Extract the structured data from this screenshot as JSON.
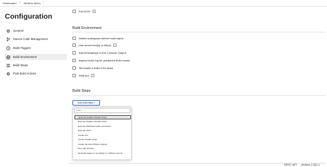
{
  "breadcrumb": {
    "items": [
      "Dashboard",
      "Jenkins demo"
    ],
    "separator": "›"
  },
  "page_title": "Configuration",
  "sidebar": {
    "items": [
      {
        "label": "General",
        "icon": "gear-icon",
        "active": false
      },
      {
        "label": "Source Code Management",
        "icon": "code-branch-icon",
        "active": false
      },
      {
        "label": "Build Triggers",
        "icon": "clock-icon",
        "active": false
      },
      {
        "label": "Build Environment",
        "icon": "globe-icon",
        "active": true
      },
      {
        "label": "Build Steps",
        "icon": "list-icon",
        "active": false
      },
      {
        "label": "Post-build Actions",
        "icon": "gear-icon",
        "active": false
      }
    ]
  },
  "triggers": {
    "poll_scm_label": "Poll SCM",
    "help": "?"
  },
  "build_environment": {
    "title": "Build Environment",
    "options": [
      {
        "label": "Delete workspace before build starts",
        "help": ""
      },
      {
        "label": "Use secret text(s) or file(s)",
        "help": "?"
      },
      {
        "label": "Add timestamps to the Console Output",
        "help": ""
      },
      {
        "label": "Inspect build log for published build scans",
        "help": ""
      },
      {
        "label": "Terminate a build if it's stuck",
        "help": ""
      },
      {
        "label": "With Ant",
        "help": "?"
      }
    ]
  },
  "build_steps": {
    "title": "Build Steps",
    "add_button_label": "Add build step",
    "add_button_caret": "▾",
    "filter_placeholder": "Filter",
    "menu_items": [
      "Execute Katalon Studio Tests",
      "Execute Katalon TestOps Plan",
      "Execute Windows batch command",
      "Execute shell",
      "Invoke Ant",
      "Invoke Gradle script",
      "Invoke top-level Maven targets",
      "Run with timeout",
      "Set build status to \"pending\" on GitHub commit"
    ],
    "highlighted_index": 0
  },
  "footer": {
    "rest_api": "REST API",
    "version": "Jenkins 2.361.1"
  },
  "colors": {
    "accent_blue": "#2e6bd6",
    "active_bg": "#eeeeee",
    "highlight_bg": "#e8e8e8"
  }
}
